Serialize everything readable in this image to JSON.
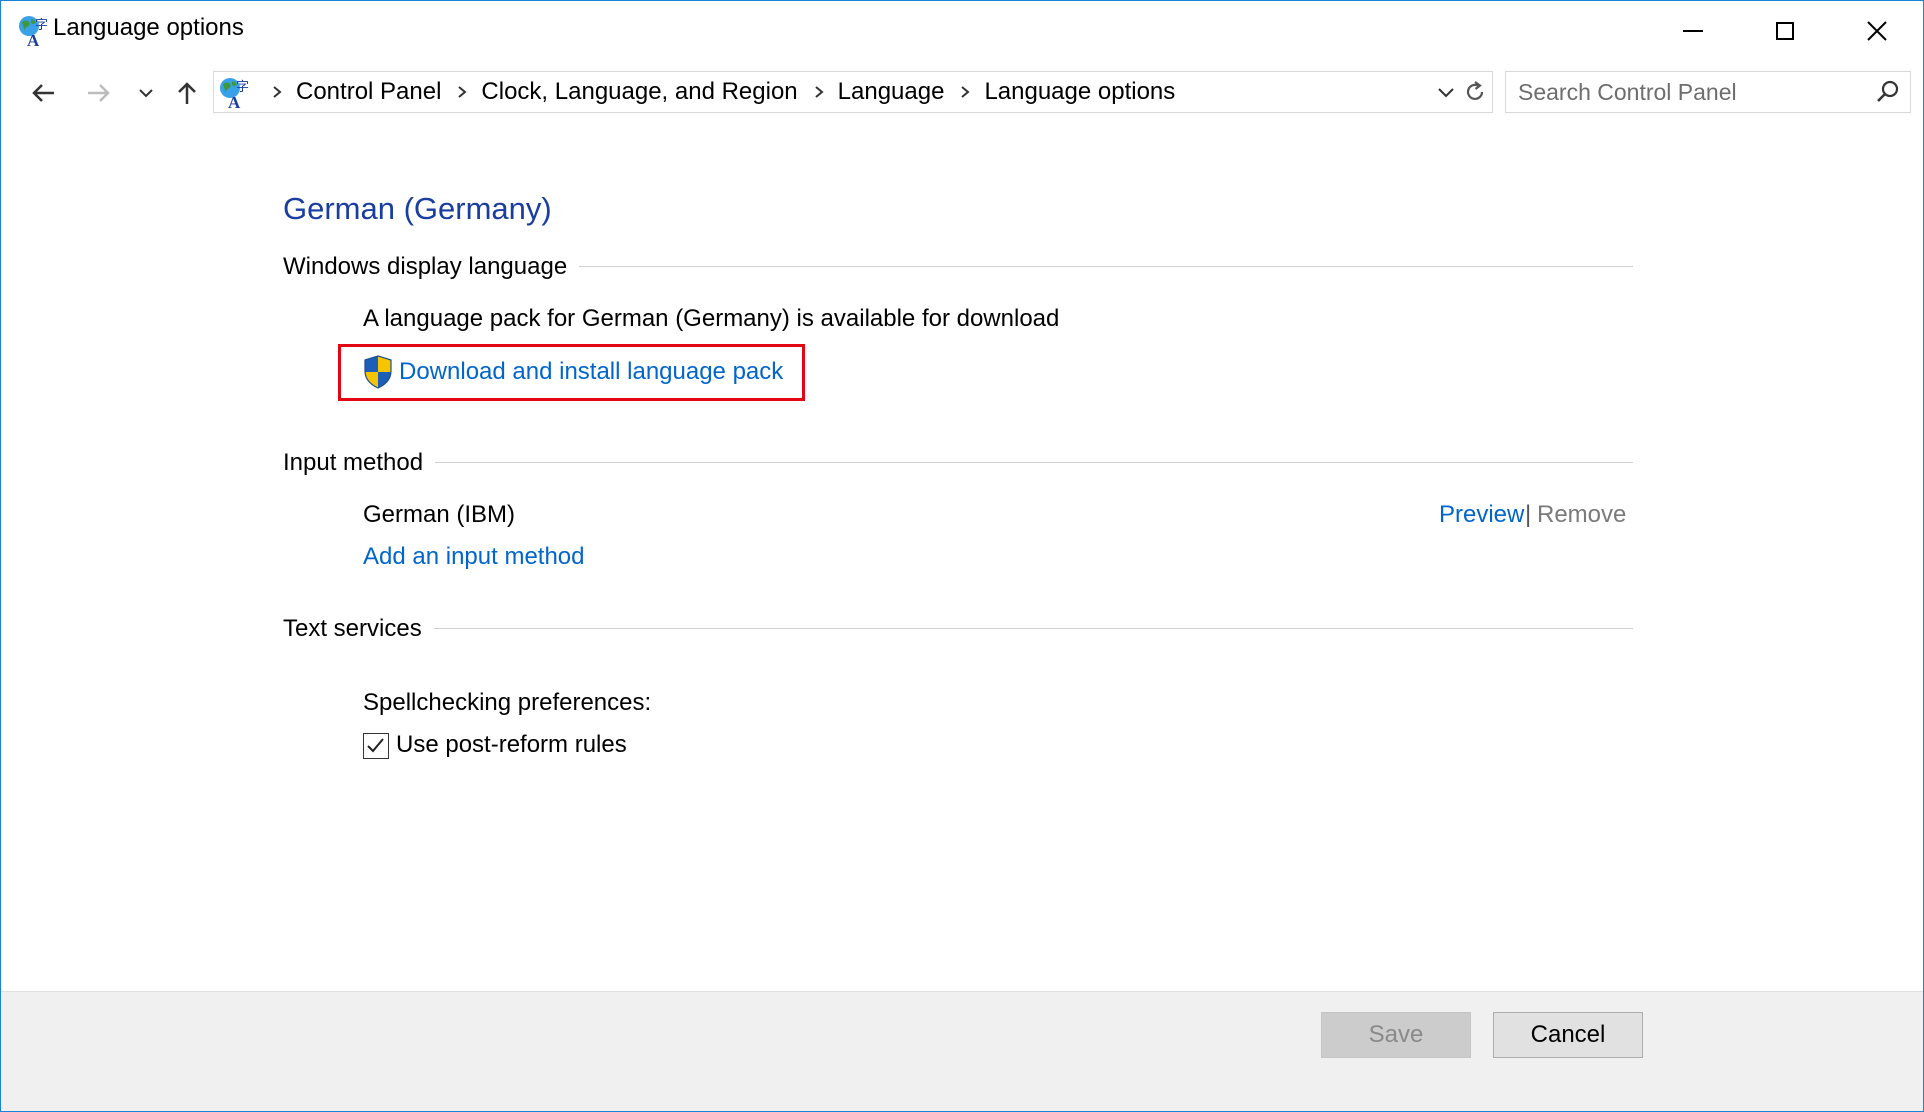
{
  "window": {
    "title": "Language options",
    "controls": {
      "minimize": "Minimize",
      "maximize": "Maximize",
      "close": "Close"
    }
  },
  "address_bar": {
    "breadcrumbs": [
      "Control Panel",
      "Clock, Language, and Region",
      "Language",
      "Language options"
    ],
    "search_placeholder": "Search Control Panel"
  },
  "content": {
    "heading": "German (Germany)",
    "display_language": {
      "title": "Windows display language",
      "message": "A language pack for German (Germany) is available for download",
      "download_link": "Download and install language pack"
    },
    "input_method": {
      "title": "Input method",
      "method_name": "German (IBM)",
      "preview_link": "Preview",
      "separator": "|",
      "remove_link": "Remove",
      "add_link": "Add an input method"
    },
    "text_services": {
      "title": "Text services",
      "spellcheck_label": "Spellchecking preferences:",
      "post_reform_checkbox": {
        "label": "Use post-reform rules",
        "checked": true
      }
    }
  },
  "footer": {
    "save_label": "Save",
    "cancel_label": "Cancel"
  },
  "colors": {
    "heading": "#1a3ea0",
    "link": "#0066cc",
    "highlight_border": "#e30613",
    "window_border": "#1883d7"
  },
  "icons": [
    "language-globe-icon",
    "back-arrow-icon",
    "forward-arrow-icon",
    "chevron-down-icon",
    "up-arrow-icon",
    "refresh-icon",
    "search-icon",
    "uac-shield-icon",
    "checkmark-icon"
  ]
}
